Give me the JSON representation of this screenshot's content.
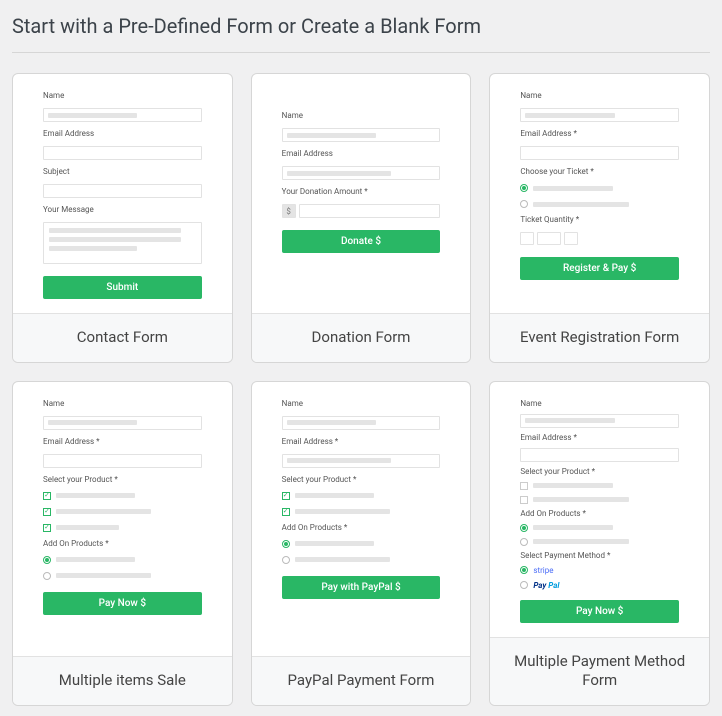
{
  "page_title": "Start with a Pre-Defined Form or Create a Blank Form",
  "common": {
    "name_label": "Name",
    "email_label": "Email Address",
    "email_label_req": "Email Address *",
    "asterisk": "*"
  },
  "cards": {
    "contact": {
      "title": "Contact Form",
      "subject_label": "Subject",
      "message_label": "Your Message",
      "button": "Submit"
    },
    "donation": {
      "title": "Donation Form",
      "amount_label": "Your Donation Amount *",
      "currency_symbol": "$",
      "button": "Donate $"
    },
    "event": {
      "title": "Event Registration Form",
      "ticket_label": "Choose your Ticket *",
      "qty_label": "Ticket Quantity *",
      "button": "Register & Pay $"
    },
    "multi_sale": {
      "title": "Multiple items Sale",
      "product_label": "Select your Product *",
      "addon_label": "Add On Products *",
      "button": "Pay Now $"
    },
    "paypal": {
      "title": "PayPal Payment Form",
      "product_label": "Select your Product *",
      "addon_label": "Add On Products *",
      "button": "Pay with PayPal $"
    },
    "multi_method": {
      "title": "Multiple Payment Method Form",
      "product_label": "Select your Product *",
      "addon_label": "Add On Products *",
      "method_label": "Select Payment Method *",
      "stripe": "stripe",
      "paypal_p1": "Pay",
      "paypal_p2": "Pal",
      "button": "Pay Now $"
    }
  }
}
